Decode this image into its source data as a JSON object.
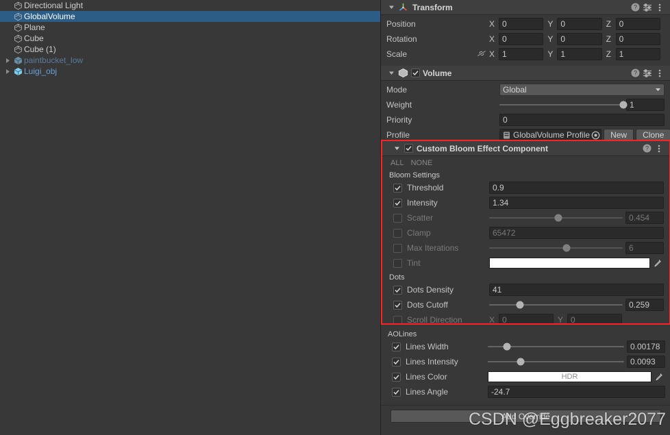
{
  "colors": {
    "selection_blue": "#2c5d87",
    "highlight_border": "#fc2424",
    "panel_bg": "#383838",
    "header_bg": "#3f3f3f",
    "field_bg": "#2a2a2a",
    "prefab_blue": "#6a9fd4"
  },
  "hierarchy": {
    "items": [
      {
        "label": "Directional Light",
        "icon": "gameobject-icon",
        "selected": false,
        "expandable": false,
        "type": "normal"
      },
      {
        "label": "GlobalVolume",
        "icon": "gameobject-icon",
        "selected": true,
        "expandable": false,
        "type": "normal"
      },
      {
        "label": "Plane",
        "icon": "gameobject-icon",
        "selected": false,
        "expandable": false,
        "type": "normal"
      },
      {
        "label": "Cube",
        "icon": "gameobject-icon",
        "selected": false,
        "expandable": false,
        "type": "normal"
      },
      {
        "label": "Cube (1)",
        "icon": "gameobject-icon",
        "selected": false,
        "expandable": false,
        "type": "normal"
      },
      {
        "label": "paintbucket_low",
        "icon": "prefab-icon",
        "selected": false,
        "expandable": true,
        "type": "prefab-inactive"
      },
      {
        "label": "Luigi_obj",
        "icon": "prefab-icon",
        "selected": false,
        "expandable": true,
        "type": "prefab"
      }
    ]
  },
  "inspector": {
    "transform": {
      "title": "Transform",
      "icon": "transform-axis-icon",
      "rows": [
        {
          "label": "Position",
          "x": "0",
          "y": "0",
          "z": "0",
          "link": false
        },
        {
          "label": "Rotation",
          "x": "0",
          "y": "0",
          "z": "0",
          "link": false
        },
        {
          "label": "Scale",
          "x": "1",
          "y": "1",
          "z": "1",
          "link": true
        }
      ],
      "axis_labels": {
        "x": "X",
        "y": "Y",
        "z": "Z"
      },
      "header_icons": [
        "help-icon",
        "preset-icon",
        "kebab-menu-icon"
      ]
    },
    "volume": {
      "title": "Volume",
      "icon": "volume-cube-icon",
      "enabled": true,
      "mode": {
        "label": "Mode",
        "value": "Global"
      },
      "weight": {
        "label": "Weight",
        "value": "1",
        "slider_pct": 100
      },
      "priority": {
        "label": "Priority",
        "value": "0"
      },
      "profile": {
        "label": "Profile",
        "value": "GlobalVolume Profile",
        "new_label": "New",
        "clone_label": "Clone"
      },
      "header_icons": [
        "help-icon",
        "preset-icon",
        "kebab-menu-icon"
      ]
    },
    "custom_bloom": {
      "title": "Custom Bloom Effect Component",
      "enabled": true,
      "all_label": "ALL",
      "none_label": "NONE",
      "header_icons": [
        "help-icon",
        "kebab-menu-icon"
      ],
      "groups": [
        {
          "name": "Bloom Settings",
          "fields": [
            {
              "label": "Threshold",
              "checked": true,
              "kind": "text",
              "value": "0.9"
            },
            {
              "label": "Intensity",
              "checked": true,
              "kind": "text",
              "value": "1.34"
            },
            {
              "label": "Scatter",
              "checked": false,
              "kind": "slider",
              "value": "0.454",
              "slider_pct": 52
            },
            {
              "label": "Clamp",
              "checked": false,
              "kind": "text",
              "value": "65472"
            },
            {
              "label": "Max Iterations",
              "checked": false,
              "kind": "slider",
              "value": "6",
              "slider_pct": 58
            },
            {
              "label": "Tint",
              "checked": false,
              "kind": "color",
              "value": "",
              "swatch": "#ffffff"
            }
          ]
        },
        {
          "name": "Dots",
          "fields": [
            {
              "label": "Dots Density",
              "checked": true,
              "kind": "text",
              "value": "41"
            },
            {
              "label": "Dots Cutoff",
              "checked": true,
              "kind": "slider",
              "value": "0.259",
              "slider_pct": 23
            },
            {
              "label": "Scroll Direction",
              "checked": false,
              "kind": "vector2",
              "x": "0",
              "y": "0"
            }
          ]
        }
      ]
    },
    "aolines": {
      "name": "AOLines",
      "fields": [
        {
          "label": "Lines Width",
          "checked": true,
          "kind": "slider",
          "value": "0.00178",
          "slider_pct": 14
        },
        {
          "label": "Lines Intensity",
          "checked": true,
          "kind": "slider",
          "value": "0.0093",
          "slider_pct": 24
        },
        {
          "label": "Lines Color",
          "checked": true,
          "kind": "color",
          "value": "HDR",
          "swatch": "#ffffff"
        },
        {
          "label": "Lines Angle",
          "checked": true,
          "kind": "text",
          "value": "-24.7"
        }
      ]
    },
    "footer": {
      "add_override_label": "Add Override"
    }
  },
  "watermark": {
    "text": "CSDN @Eggbreaker2077"
  }
}
